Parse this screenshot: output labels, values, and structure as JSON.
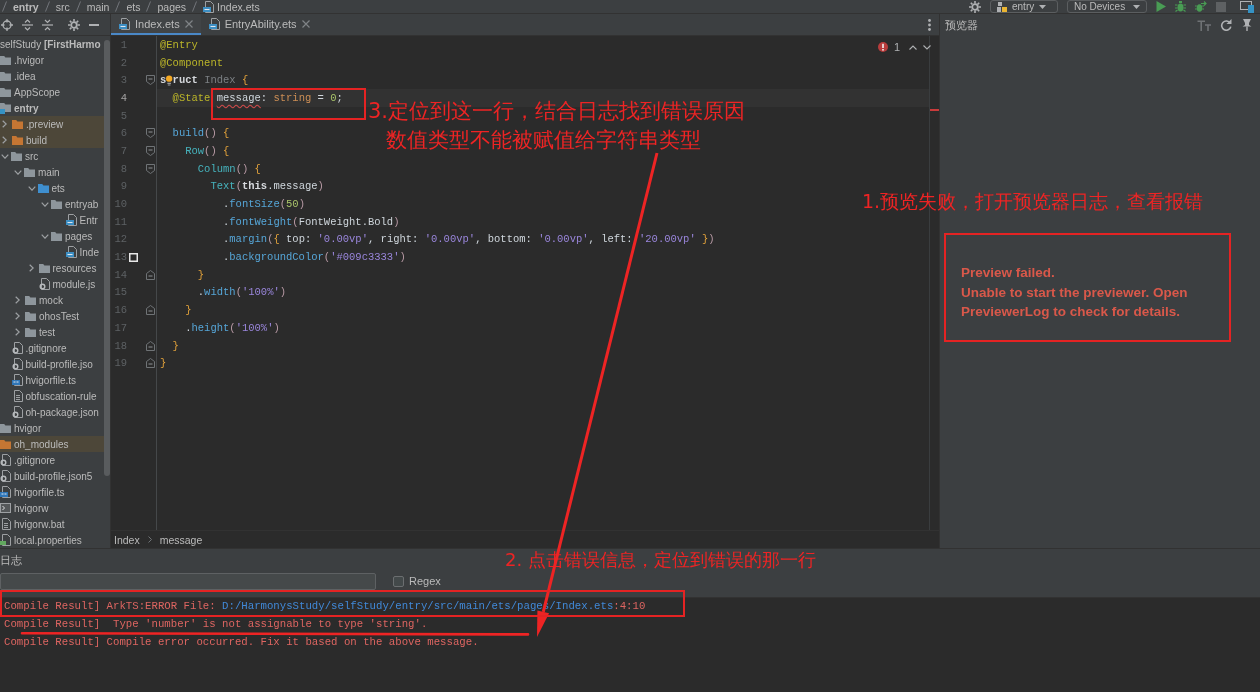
{
  "top_bar": {
    "breadcrumb": [
      {
        "label": "entry",
        "kind": "module"
      },
      {
        "label": "src",
        "kind": "folder"
      },
      {
        "label": "main",
        "kind": "folder"
      },
      {
        "label": "ets",
        "kind": "folder"
      },
      {
        "label": "pages",
        "kind": "folder"
      },
      {
        "label": "Index.ets",
        "kind": "file"
      }
    ],
    "module_selector": "entry",
    "device_selector": "No Devices"
  },
  "project": {
    "tree": [
      {
        "label": "selfStudy **[FirstHarmo**",
        "children": [
          {
            "label": ".hvigor",
            "kind": "folder"
          },
          {
            "label": ".idea",
            "kind": "folder"
          },
          {
            "label": "AppScope",
            "kind": "folder"
          },
          {
            "label": "entry",
            "kind": "module",
            "children": [
              {
                "label": ".preview",
                "kind": "excluded",
                "expanded": false
              },
              {
                "label": "build",
                "kind": "excluded",
                "expanded": false
              },
              {
                "label": "src",
                "kind": "folder",
                "expanded": true,
                "children": [
                  {
                    "label": "main",
                    "kind": "folder",
                    "expanded": true,
                    "children": [
                      {
                        "label": "ets",
                        "kind": "source",
                        "expanded": true,
                        "children": [
                          {
                            "label": "entryab",
                            "kind": "folder",
                            "expanded": true,
                            "children": [
                              {
                                "label": "Entr",
                                "kind": "ets"
                              }
                            ]
                          },
                          {
                            "label": "pages",
                            "kind": "folder",
                            "expanded": true,
                            "children": [
                              {
                                "label": "Inde",
                                "kind": "ets"
                              }
                            ]
                          }
                        ]
                      },
                      {
                        "label": "resources",
                        "kind": "folder",
                        "expanded": false
                      },
                      {
                        "label": "module.js",
                        "kind": "config"
                      }
                    ]
                  },
                  {
                    "label": "mock",
                    "kind": "folder",
                    "expanded": false
                  },
                  {
                    "label": "ohosTest",
                    "kind": "folder",
                    "expanded": false
                  },
                  {
                    "label": "test",
                    "kind": "folder",
                    "expanded": false
                  }
                ]
              },
              {
                "label": ".gitignore",
                "kind": "config"
              },
              {
                "label": "build-profile.jso",
                "kind": "config"
              },
              {
                "label": "hvigorfile.ts",
                "kind": "ts"
              },
              {
                "label": "obfuscation-rule",
                "kind": "text"
              },
              {
                "label": "oh-package.json",
                "kind": "config"
              }
            ]
          },
          {
            "label": "hvigor",
            "kind": "folder"
          },
          {
            "label": "oh_modules",
            "kind": "excluded"
          },
          {
            "label": ".gitignore",
            "kind": "config"
          },
          {
            "label": "build-profile.json5",
            "kind": "config"
          },
          {
            "label": "hvigorfile.ts",
            "kind": "ts"
          },
          {
            "label": "hvigorw",
            "kind": "script"
          },
          {
            "label": "hvigorw.bat",
            "kind": "text"
          },
          {
            "label": "local.properties",
            "kind": "properties"
          }
        ]
      }
    ]
  },
  "editor": {
    "tabs": [
      {
        "label": "Index.ets",
        "selected": true
      },
      {
        "label": "EntryAbility.ets",
        "selected": false
      }
    ],
    "error_count": "1",
    "lines": [
      {
        "number": "1",
        "current": false,
        "tokens": [
          {
            "text": "@Entry",
            "kind": "decorator"
          }
        ]
      },
      {
        "number": "2",
        "current": false,
        "tokens": [
          {
            "text": "@Component",
            "kind": "decorator"
          }
        ]
      },
      {
        "number": "3",
        "current": false,
        "fold_start": true,
        "tokens": [
          {
            "text": "s",
            "kind": "keyword"
          },
          {
            "kind": "bulb"
          },
          {
            "text": "ruct",
            "kind": "keyword"
          },
          {
            "text": " Index",
            "kind": "dim"
          },
          {
            "text": " {",
            "kind": "brace"
          }
        ]
      },
      {
        "number": "4",
        "current": true,
        "tokens": [
          {
            "text": "  @State ",
            "kind": "decorator"
          },
          {
            "text": "message",
            "kind": "plain",
            "error": true
          },
          {
            "text": ": ",
            "kind": "plain"
          },
          {
            "text": "string",
            "kind": "type"
          },
          {
            "text": " = ",
            "kind": "plain"
          },
          {
            "text": "0",
            "kind": "number"
          },
          {
            "text": ";",
            "kind": "plain"
          }
        ]
      },
      {
        "number": "5",
        "current": false
      },
      {
        "number": "6",
        "current": false,
        "fold_start": true,
        "tokens": [
          {
            "text": "  build",
            "kind": "method"
          },
          {
            "text": "()",
            "kind": "paren"
          },
          {
            "text": " {",
            "kind": "brace"
          }
        ]
      },
      {
        "number": "7",
        "current": false,
        "fold_start": true,
        "tokens": [
          {
            "text": "    Row",
            "kind": "component"
          },
          {
            "text": "()",
            "kind": "paren"
          },
          {
            "text": " {",
            "kind": "brace"
          }
        ]
      },
      {
        "number": "8",
        "current": false,
        "fold_start": true,
        "tokens": [
          {
            "text": "      Column",
            "kind": "component"
          },
          {
            "text": "()",
            "kind": "paren"
          },
          {
            "text": " {",
            "kind": "brace"
          }
        ]
      },
      {
        "number": "9",
        "current": false,
        "tokens": [
          {
            "text": "        Text",
            "kind": "component"
          },
          {
            "text": "(",
            "kind": "paren"
          },
          {
            "text": "this",
            "kind": "this"
          },
          {
            "text": ".message",
            "kind": "plain"
          },
          {
            "text": ")",
            "kind": "paren"
          }
        ]
      },
      {
        "number": "10",
        "current": false,
        "tokens": [
          {
            "text": "          .",
            "kind": "plain"
          },
          {
            "text": "fontSize",
            "kind": "method"
          },
          {
            "text": "(",
            "kind": "paren"
          },
          {
            "text": "50",
            "kind": "number"
          },
          {
            "text": ")",
            "kind": "paren"
          }
        ]
      },
      {
        "number": "11",
        "current": false,
        "tokens": [
          {
            "text": "          .",
            "kind": "plain"
          },
          {
            "text": "fontWeight",
            "kind": "method"
          },
          {
            "text": "(",
            "kind": "paren"
          },
          {
            "text": "FontWeight.Bold",
            "kind": "plain"
          },
          {
            "text": ")",
            "kind": "paren"
          }
        ]
      },
      {
        "number": "12",
        "current": false,
        "tokens": [
          {
            "text": "          .",
            "kind": "plain"
          },
          {
            "text": "margin",
            "kind": "method"
          },
          {
            "text": "(",
            "kind": "paren"
          },
          {
            "text": "{",
            "kind": "brace"
          },
          {
            "text": " top: ",
            "kind": "plain"
          },
          {
            "text": "'0.00vp'",
            "kind": "string"
          },
          {
            "text": ", right: ",
            "kind": "plain"
          },
          {
            "text": "'0.00vp'",
            "kind": "string"
          },
          {
            "text": ", bottom: ",
            "kind": "plain"
          },
          {
            "text": "'0.00vp'",
            "kind": "string"
          },
          {
            "text": ", left: ",
            "kind": "plain"
          },
          {
            "text": "'20.00vp'",
            "kind": "string"
          },
          {
            "text": " }",
            "kind": "brace"
          },
          {
            "text": ")",
            "kind": "paren"
          }
        ]
      },
      {
        "number": "13",
        "current": false,
        "color_swatch": true,
        "tokens": [
          {
            "text": "          .",
            "kind": "plain"
          },
          {
            "text": "backgroundColor",
            "kind": "method"
          },
          {
            "text": "(",
            "kind": "paren"
          },
          {
            "text": "'#009c3333'",
            "kind": "string"
          },
          {
            "text": ")",
            "kind": "paren"
          }
        ]
      },
      {
        "number": "14",
        "current": false,
        "fold_end": true,
        "tokens": [
          {
            "text": "      }",
            "kind": "brace"
          }
        ]
      },
      {
        "number": "15",
        "current": false,
        "tokens": [
          {
            "text": "      .",
            "kind": "plain"
          },
          {
            "text": "width",
            "kind": "method"
          },
          {
            "text": "(",
            "kind": "paren"
          },
          {
            "text": "'100%'",
            "kind": "string"
          },
          {
            "text": ")",
            "kind": "paren"
          }
        ]
      },
      {
        "number": "16",
        "current": false,
        "fold_end": true,
        "tokens": [
          {
            "text": "    }",
            "kind": "brace"
          }
        ]
      },
      {
        "number": "17",
        "current": false,
        "tokens": [
          {
            "text": "    .",
            "kind": "plain"
          },
          {
            "text": "height",
            "kind": "method"
          },
          {
            "text": "(",
            "kind": "paren"
          },
          {
            "text": "'100%'",
            "kind": "string"
          },
          {
            "text": ")",
            "kind": "paren"
          }
        ]
      },
      {
        "number": "18",
        "current": false,
        "fold_end": true,
        "tokens": [
          {
            "text": "  }",
            "kind": "brace"
          }
        ]
      },
      {
        "number": "19",
        "current": false,
        "fold_end": true,
        "tokens": [
          {
            "text": "}",
            "kind": "brace"
          }
        ]
      }
    ],
    "breadcrumb": [
      "Index",
      "message"
    ]
  },
  "preview": {
    "title": "预览器",
    "message": [
      "Preview failed.",
      "Unable to start the previewer. Open PreviewerLog to check for details."
    ]
  },
  "log": {
    "title": "日志",
    "regex": {
      "label": "Regex",
      "checked": false
    },
    "lines": [
      {
        "segments": [
          {
            "text": "Compile Result] ArkTS:ERROR File: ",
            "kind": "text"
          },
          {
            "text": "D:/HarmonysStudy/selfStudy/entry/src/main/ets/pages/Index.ets",
            "kind": "link"
          },
          {
            "text": ":4:10",
            "kind": "text"
          }
        ]
      },
      {
        "segments": [
          {
            "text": "Compile Result]  Type 'number' is not assignable to type 'string'.",
            "kind": "text"
          }
        ]
      },
      {
        "segments": [
          {
            "text": "Compile Result] Compile error occurred. Fix it based on the above message.",
            "kind": "text"
          }
        ]
      }
    ]
  },
  "annotations": [
    {
      "kind": "box"
    },
    {
      "kind": "note",
      "lines": [
        "3.定位到这一行，结合日志找到错误原因",
        "数值类型不能被赋值给字符串类型"
      ]
    },
    {
      "kind": "arrow"
    },
    {
      "kind": "note",
      "lines": [
        "1.预览失败，打开预览器日志，查看报错"
      ]
    },
    {
      "kind": "box"
    },
    {
      "kind": "note",
      "lines": [
        "2. 点击错误信息，定位到错误的那一行"
      ]
    },
    {
      "kind": "box"
    },
    {
      "kind": "underline"
    }
  ]
}
